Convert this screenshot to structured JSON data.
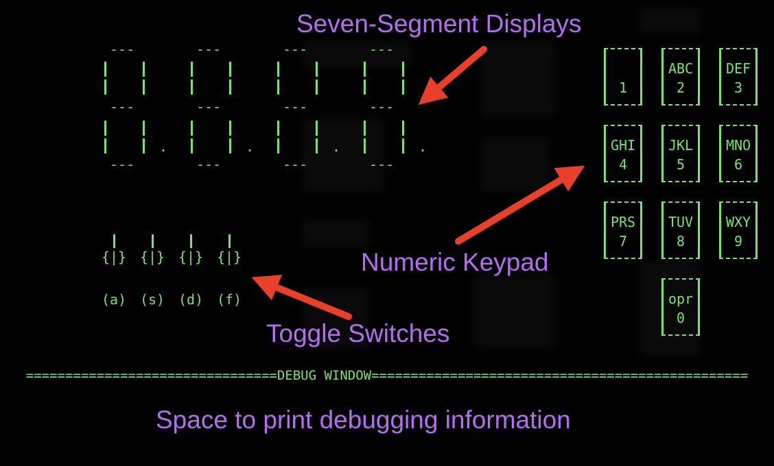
{
  "seven_segment": {
    "digit_count": 4,
    "segment_bar": "---",
    "decimal_point": "."
  },
  "toggles": [
    {
      "body": "{|}",
      "key": "(a)"
    },
    {
      "body": "{|}",
      "key": "(s)"
    },
    {
      "body": "{|}",
      "key": "(d)"
    },
    {
      "body": "{|}",
      "key": "(f)"
    }
  ],
  "keypad": [
    {
      "letters": "",
      "number": "1"
    },
    {
      "letters": "ABC",
      "number": "2"
    },
    {
      "letters": "DEF",
      "number": "3"
    },
    {
      "letters": "GHI",
      "number": "4"
    },
    {
      "letters": "JKL",
      "number": "5"
    },
    {
      "letters": "MNO",
      "number": "6"
    },
    {
      "letters": "PRS",
      "number": "7"
    },
    {
      "letters": "TUV",
      "number": "8"
    },
    {
      "letters": "WXY",
      "number": "9"
    },
    {
      "letters": "opr",
      "number": "0"
    }
  ],
  "debug": {
    "bar_left": "================================",
    "title": "DEBUG WINDOW",
    "bar_right": "================================================"
  },
  "annotations": {
    "seven_segment": "Seven-Segment Displays",
    "keypad": "Numeric Keypad",
    "toggles": "Toggle Switches",
    "debug": "Space to print debugging information"
  },
  "colors": {
    "terminal_green": "#7be36f",
    "annotation_purple": "#b36ff0",
    "arrow_red": "#e8402a",
    "background": "#020203"
  }
}
